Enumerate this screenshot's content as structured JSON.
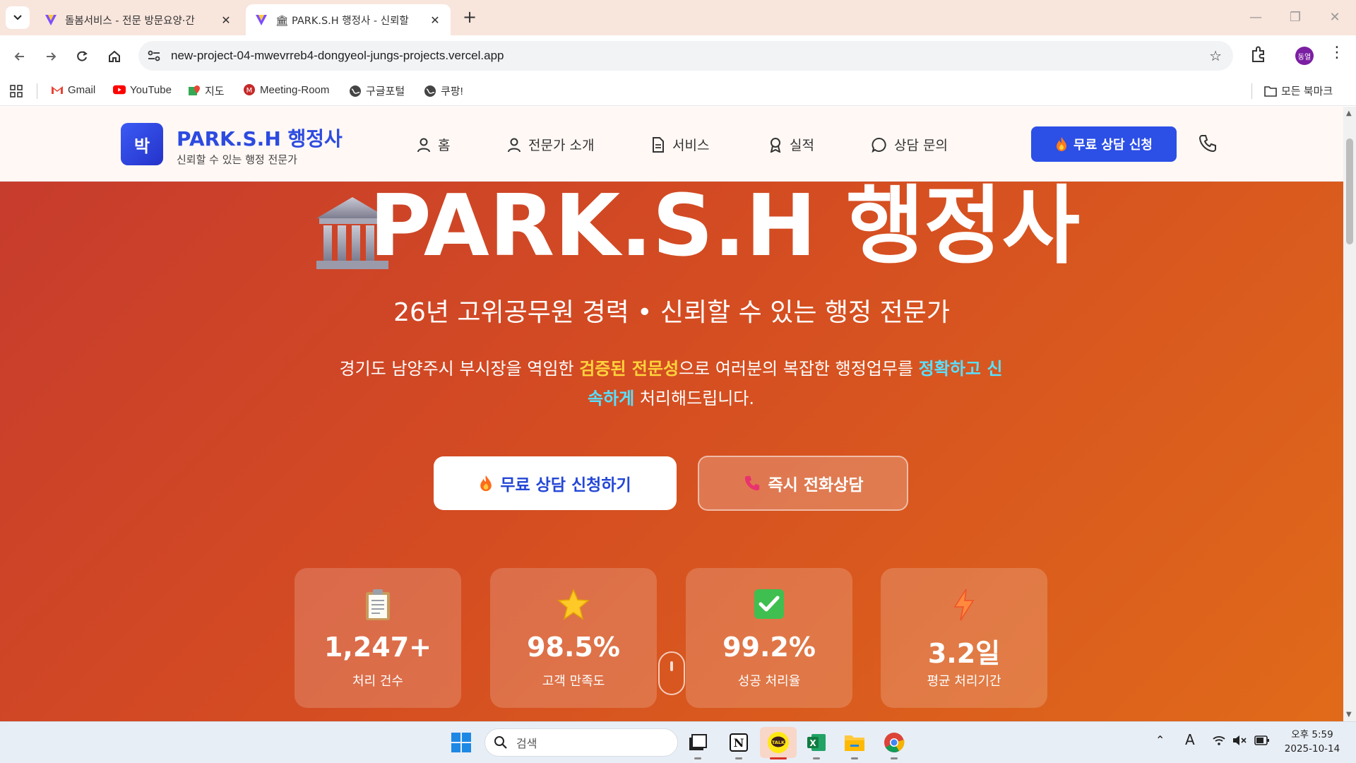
{
  "browser": {
    "tabs": [
      {
        "title": "돌봄서비스 - 전문 방문요양·간",
        "active": false
      },
      {
        "title": "🏛 PARK.S.H 행정사 - 신뢰할 ",
        "active": true
      }
    ],
    "url": "new-project-04-mwevrreb4-dongyeol-jungs-projects.vercel.app",
    "profile_initials": "동열",
    "bookmarks": [
      "Gmail",
      "YouTube",
      "지도",
      "Meeting-Room",
      "구글포털",
      "쿠팡!"
    ],
    "all_bookmarks_label": "모든 북마크"
  },
  "site": {
    "logo_char": "박",
    "brand_title": "PARK.S.H 행정사",
    "brand_subtitle": "신뢰할 수 있는 행정 전문가",
    "nav": [
      "홈",
      "전문가 소개",
      "서비스",
      "실적",
      "상담 문의"
    ],
    "cta_header": "무료 상담 신청"
  },
  "hero": {
    "title": "PARK.S.H 행정사",
    "subtitle": "26년 고위공무원 경력 • 신뢰할 수 있는 행정 전문가",
    "desc_part1": "경기도 남양주시 부시장을 역임한 ",
    "desc_highlight1": "검증된 전문성",
    "desc_part2": "으로 여러분의 복잡한 행정업무를 ",
    "desc_highlight2": "정확하고 신속하게",
    "desc_part3": " 처리해드립니다.",
    "btn_primary": "무료 상담 신청하기",
    "btn_secondary": "즉시 전화상담"
  },
  "stats": [
    {
      "value": "1,247+",
      "label": "처리 건수",
      "icon": "clipboard-icon"
    },
    {
      "value": "98.5%",
      "label": "고객 만족도",
      "icon": "star-icon"
    },
    {
      "value": "99.2%",
      "label": "성공 처리율",
      "icon": "check-icon"
    },
    {
      "value": "3.2일",
      "label": "평균 처리기간",
      "icon": "lightning-icon"
    }
  ],
  "taskbar": {
    "search_placeholder": "검색",
    "time": "오후 5:59",
    "date": "2025-10-14"
  },
  "colors": {
    "brand_blue": "#2c4fe6",
    "hero_start": "#c53a2e",
    "hero_end": "#e06a1a",
    "highlight_yellow": "#ffd43b",
    "highlight_cyan": "#57e0ff"
  }
}
